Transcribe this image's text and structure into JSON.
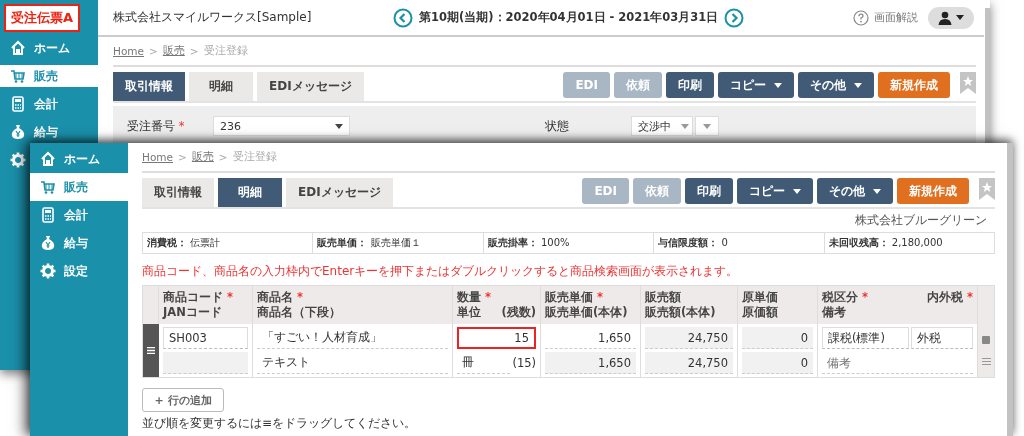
{
  "badge": {
    "label": "受注伝票A"
  },
  "back_window": {
    "header": {
      "company": "株式会社スマイルワークス[Sample]",
      "period": "第10期(当期)：2020年04月01日 - 2021年03月31日",
      "help": "画面解説"
    },
    "sidebar": [
      {
        "label": "ホーム",
        "selected": false
      },
      {
        "label": "販売",
        "selected": true
      },
      {
        "label": "会計",
        "selected": false
      },
      {
        "label": "給与",
        "selected": false
      },
      {
        "selected": false
      }
    ],
    "breadcrumb": [
      {
        "label": "Home",
        "kind": "link"
      },
      {
        "label": ">",
        "kind": "separator"
      },
      {
        "label": "販売",
        "kind": "link"
      },
      {
        "label": ">",
        "kind": "separator"
      },
      {
        "label": "受注登録",
        "kind": "current"
      }
    ],
    "tabs": [
      {
        "label": "取引情報",
        "selected": true
      },
      {
        "label": "明細",
        "selected": false
      },
      {
        "label": "EDIメッセージ",
        "selected": false
      }
    ],
    "buttons": [
      {
        "label": "EDI",
        "kind": "plain",
        "disabled": true
      },
      {
        "label": "依頼",
        "kind": "plain",
        "disabled": true
      },
      {
        "label": "印刷",
        "kind": "plain",
        "disabled": false
      },
      {
        "label": "コピー",
        "kind": "menu",
        "disabled": false
      },
      {
        "label": "その他",
        "kind": "menu",
        "disabled": false
      },
      {
        "label": "新規作成",
        "kind": "create",
        "disabled": false
      }
    ],
    "form": [
      {
        "label": "受注番号",
        "mark": "*",
        "value": "236",
        "kind": "select"
      },
      {
        "label": "状態",
        "value": "交渉中",
        "kind": "split-select"
      }
    ]
  },
  "front_window": {
    "sidebar": [
      {
        "label": "ホーム",
        "selected": false
      },
      {
        "label": "販売",
        "selected": true
      },
      {
        "label": "会計",
        "selected": false
      },
      {
        "label": "給与",
        "selected": false
      },
      {
        "label": "設定",
        "selected": false
      }
    ],
    "breadcrumb": [
      {
        "label": "Home",
        "kind": "link"
      },
      {
        "label": ">",
        "kind": "separator"
      },
      {
        "label": "販売",
        "kind": "link"
      },
      {
        "label": ">",
        "kind": "separator"
      },
      {
        "label": "受注登録",
        "kind": "current"
      }
    ],
    "tabs": [
      {
        "label": "取引情報",
        "selected": false
      },
      {
        "label": "明細",
        "selected": true
      },
      {
        "label": "EDIメッセージ",
        "selected": false
      }
    ],
    "buttons": [
      {
        "label": "EDI",
        "kind": "plain",
        "disabled": true
      },
      {
        "label": "依頼",
        "kind": "plain",
        "disabled": true
      },
      {
        "label": "印刷",
        "kind": "plain",
        "disabled": false
      },
      {
        "label": "コピー",
        "kind": "menu",
        "disabled": false
      },
      {
        "label": "その他",
        "kind": "menu",
        "disabled": false
      },
      {
        "label": "新規作成",
        "kind": "create",
        "disabled": false
      }
    ],
    "customer": "株式会社ブルーグリーン",
    "summary": [
      {
        "label": "消費税：",
        "value": "伝票計"
      },
      {
        "label": "販売単価：",
        "value": "販売単価１"
      },
      {
        "label": "販売掛率：",
        "value": "100%"
      },
      {
        "label": "与信限度額：",
        "value": "0"
      },
      {
        "label": "未回収残高：",
        "value": "2,180,000"
      }
    ],
    "notice": "商品コード、商品名の入力枠内でEnterキーを押下またはダブルクリックすると商品検索画面が表示されます。",
    "table": {
      "columns": [
        {
          "top": [
            {
              "text": "商品コード",
              "mark": "*"
            }
          ],
          "bottom": [
            {
              "text": "JANコード"
            }
          ]
        },
        {
          "top": [
            {
              "text": "商品名",
              "mark": "*"
            }
          ],
          "bottom": [
            {
              "text": "商品名（下段）"
            }
          ]
        },
        {
          "top": [
            {
              "text": "数量",
              "mark": "*"
            }
          ],
          "bottom": [
            {
              "text": "単位"
            },
            {
              "text": "(残数)"
            }
          ]
        },
        {
          "top": [
            {
              "text": "販売単価",
              "mark": "*"
            }
          ],
          "bottom": [
            {
              "text": "販売単価(本体)"
            }
          ]
        },
        {
          "top": [
            {
              "text": "販売額"
            }
          ],
          "bottom": [
            {
              "text": "販売額(本体)"
            }
          ]
        },
        {
          "top": [
            {
              "text": "原単価"
            }
          ],
          "bottom": [
            {
              "text": "原価額"
            }
          ]
        },
        {
          "top": [
            {
              "text": "税区分",
              "mark": "*"
            },
            {
              "text": "内外税",
              "mark": "*"
            }
          ],
          "bottom": [
            {
              "text": "備考"
            }
          ]
        }
      ],
      "rows": [
        {
          "code": "SH003",
          "name": "「すごい！人材育成」",
          "name_sub": "テキスト",
          "quantity": "15",
          "quantity_focused": true,
          "unit": "冊",
          "remaining": "(15)",
          "unit_price": "1,650",
          "unit_price_net": "1,650",
          "amount": "24,750",
          "amount_net": "24,750",
          "cost_price": "0",
          "cost_amount": "0",
          "tax_category": "課税(標準)",
          "tax_mode": "外税",
          "memo": {
            "placeholder": "備考"
          }
        }
      ]
    },
    "add_row": "+ 行の追加",
    "hint": "並び順を変更するには≡をドラッグしてください。"
  }
}
